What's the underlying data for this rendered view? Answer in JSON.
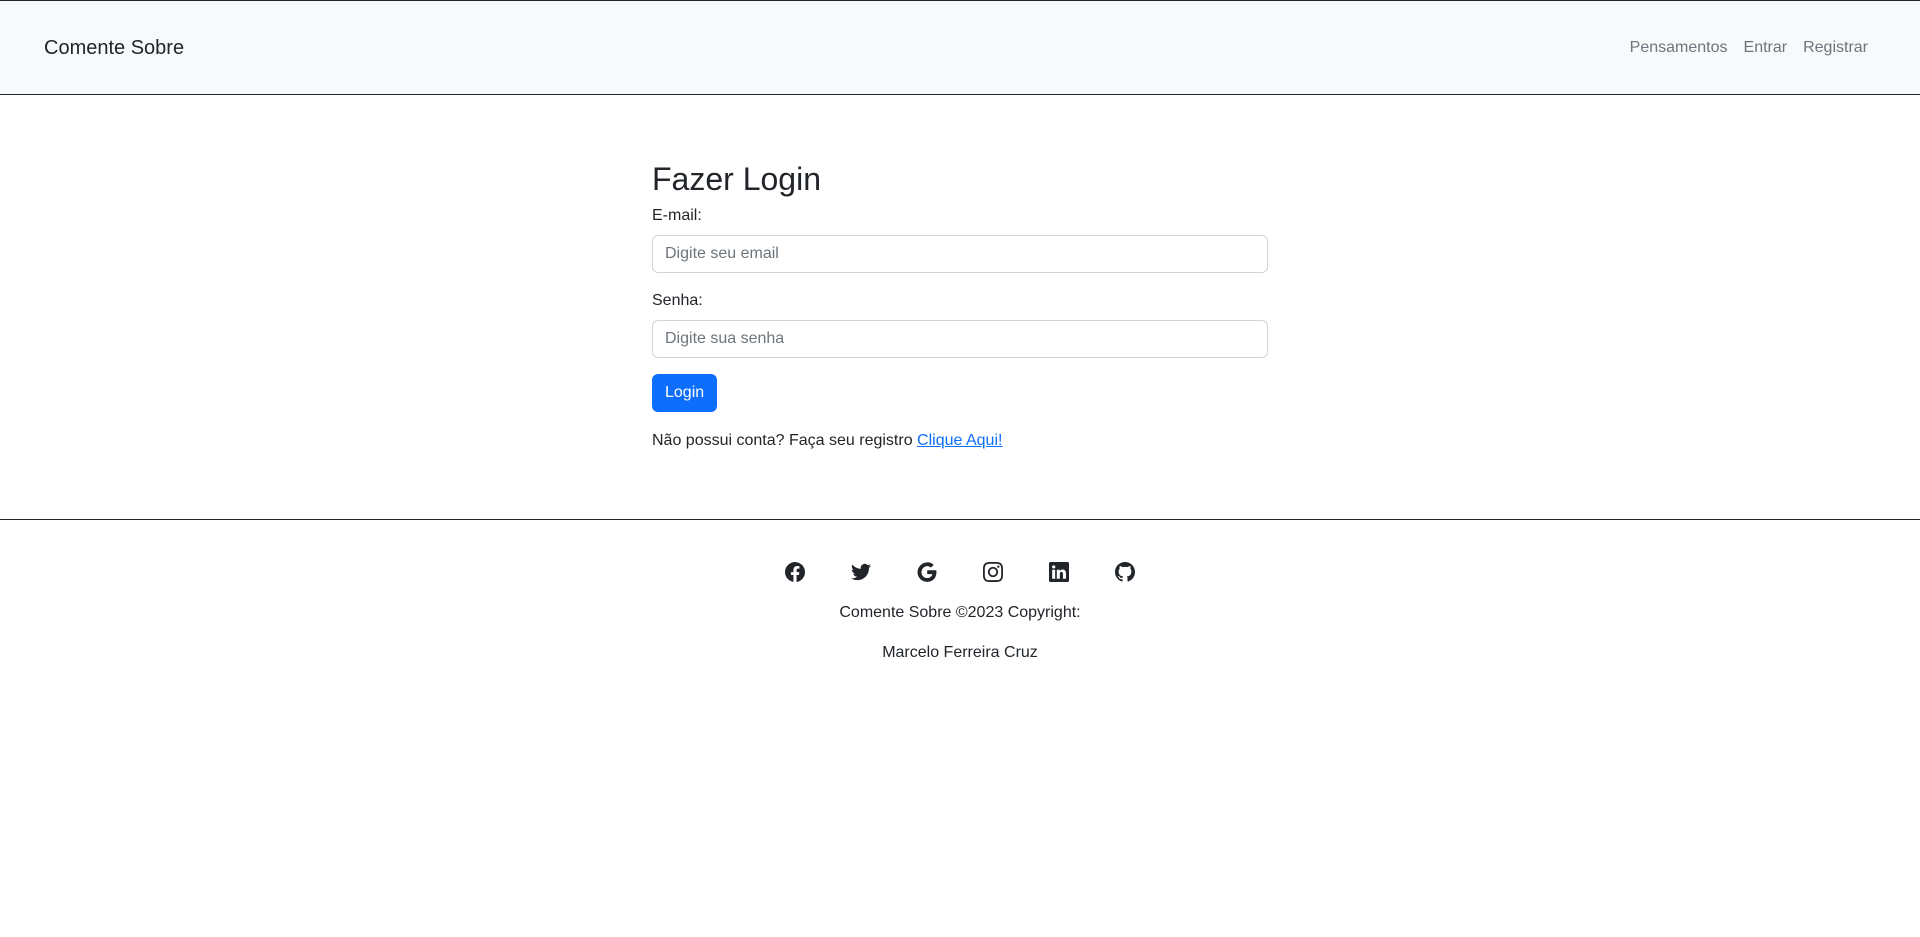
{
  "navbar": {
    "brand": "Comente Sobre",
    "links": [
      "Pensamentos",
      "Entrar",
      "Registrar"
    ]
  },
  "login": {
    "title": "Fazer Login",
    "email_label": "E-mail:",
    "email_placeholder": "Digite seu email",
    "email_value": "",
    "password_label": "Senha:",
    "password_placeholder": "Digite sua senha",
    "password_value": "",
    "submit_label": "Login",
    "register_text": "Não possui conta? Faça seu registro",
    "register_link": "Clique Aqui!"
  },
  "footer": {
    "social_icons": [
      "facebook-icon",
      "twitter-icon",
      "google-icon",
      "instagram-icon",
      "linkedin-icon",
      "github-icon"
    ],
    "copyright": "Comente Sobre ©2023 Copyright:",
    "author": "Marcelo Ferreira Cruz"
  },
  "colors": {
    "primary": "#0d6efd",
    "navbar_bg": "#f8f9fa",
    "nav_link": "#6c757d",
    "text": "#212529"
  }
}
